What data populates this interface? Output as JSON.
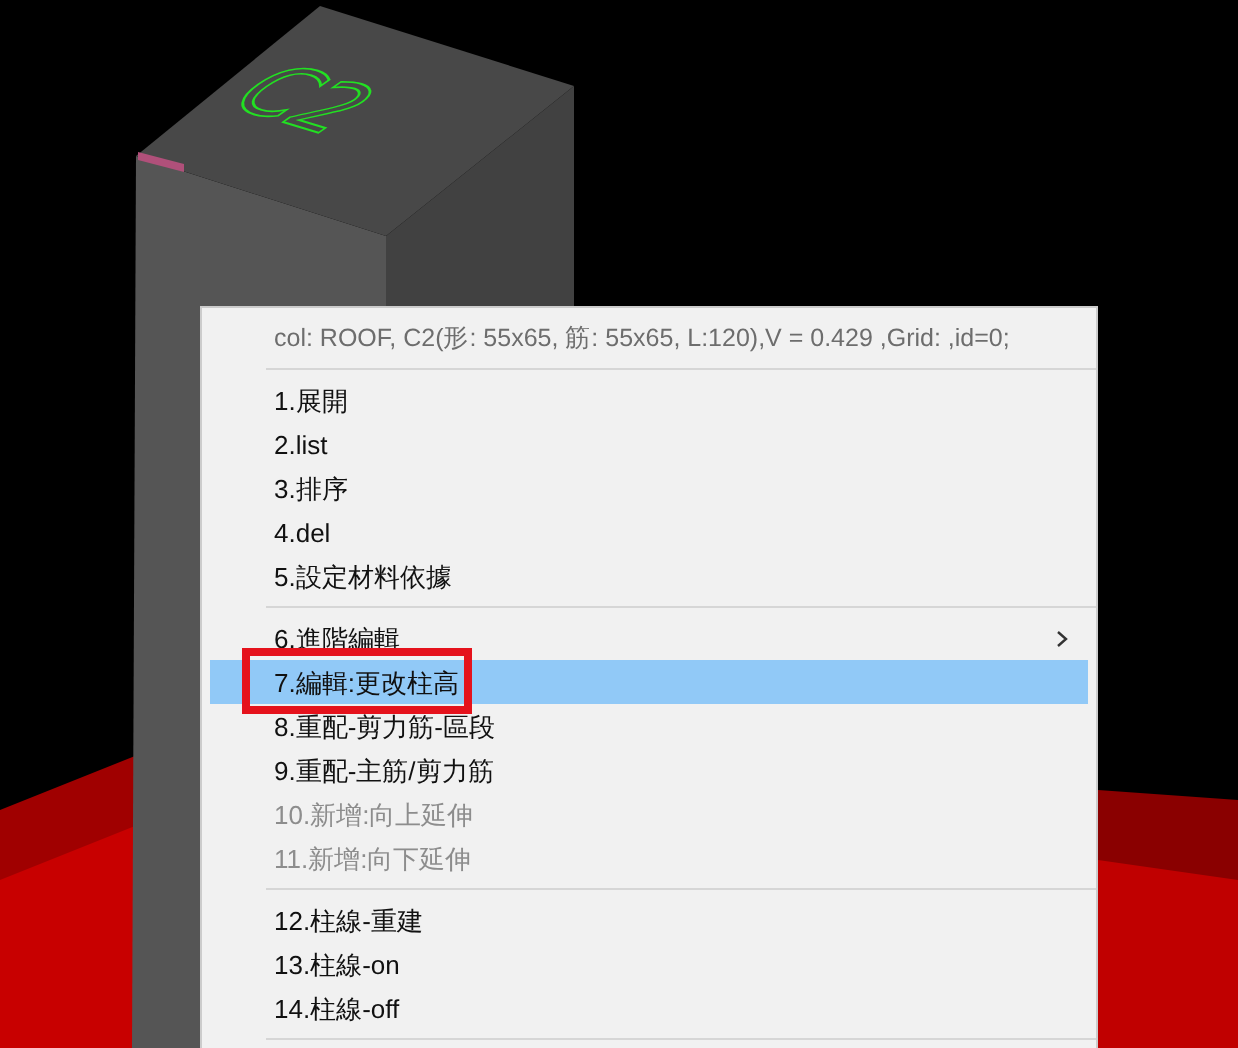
{
  "viewport": {
    "column_label": "C2"
  },
  "context_menu": {
    "header": "col: ROOF, C2(形: 55x65, 筋: 55x65, L:120),V = 0.429 ,Grid: ,id=0;",
    "sections": [
      [
        {
          "label": "1.展開",
          "disabled": false,
          "selected": false,
          "submenu": false,
          "annotated": false
        },
        {
          "label": "2.list",
          "disabled": false,
          "selected": false,
          "submenu": false,
          "annotated": false
        },
        {
          "label": "3.排序",
          "disabled": false,
          "selected": false,
          "submenu": false,
          "annotated": false
        },
        {
          "label": "4.del",
          "disabled": false,
          "selected": false,
          "submenu": false,
          "annotated": false
        },
        {
          "label": "5.設定材料依據",
          "disabled": false,
          "selected": false,
          "submenu": false,
          "annotated": false
        }
      ],
      [
        {
          "label": "6.進階編輯",
          "disabled": false,
          "selected": false,
          "submenu": true,
          "annotated": false
        },
        {
          "label": "7.編輯:更改柱高",
          "disabled": false,
          "selected": true,
          "submenu": false,
          "annotated": true
        },
        {
          "label": "8.重配-剪力筋-區段",
          "disabled": false,
          "selected": false,
          "submenu": false,
          "annotated": false
        },
        {
          "label": "9.重配-主筋/剪力筋",
          "disabled": false,
          "selected": false,
          "submenu": false,
          "annotated": false
        },
        {
          "label": "10.新增:向上延伸",
          "disabled": true,
          "selected": false,
          "submenu": false,
          "annotated": false
        },
        {
          "label": "11.新增:向下延伸",
          "disabled": true,
          "selected": false,
          "submenu": false,
          "annotated": false
        }
      ],
      [
        {
          "label": "12.柱線-重建",
          "disabled": false,
          "selected": false,
          "submenu": false,
          "annotated": false
        },
        {
          "label": "13.柱線-on",
          "disabled": false,
          "selected": false,
          "submenu": false,
          "annotated": false
        },
        {
          "label": "14.柱線-off",
          "disabled": false,
          "selected": false,
          "submenu": false,
          "annotated": false
        }
      ]
    ]
  }
}
